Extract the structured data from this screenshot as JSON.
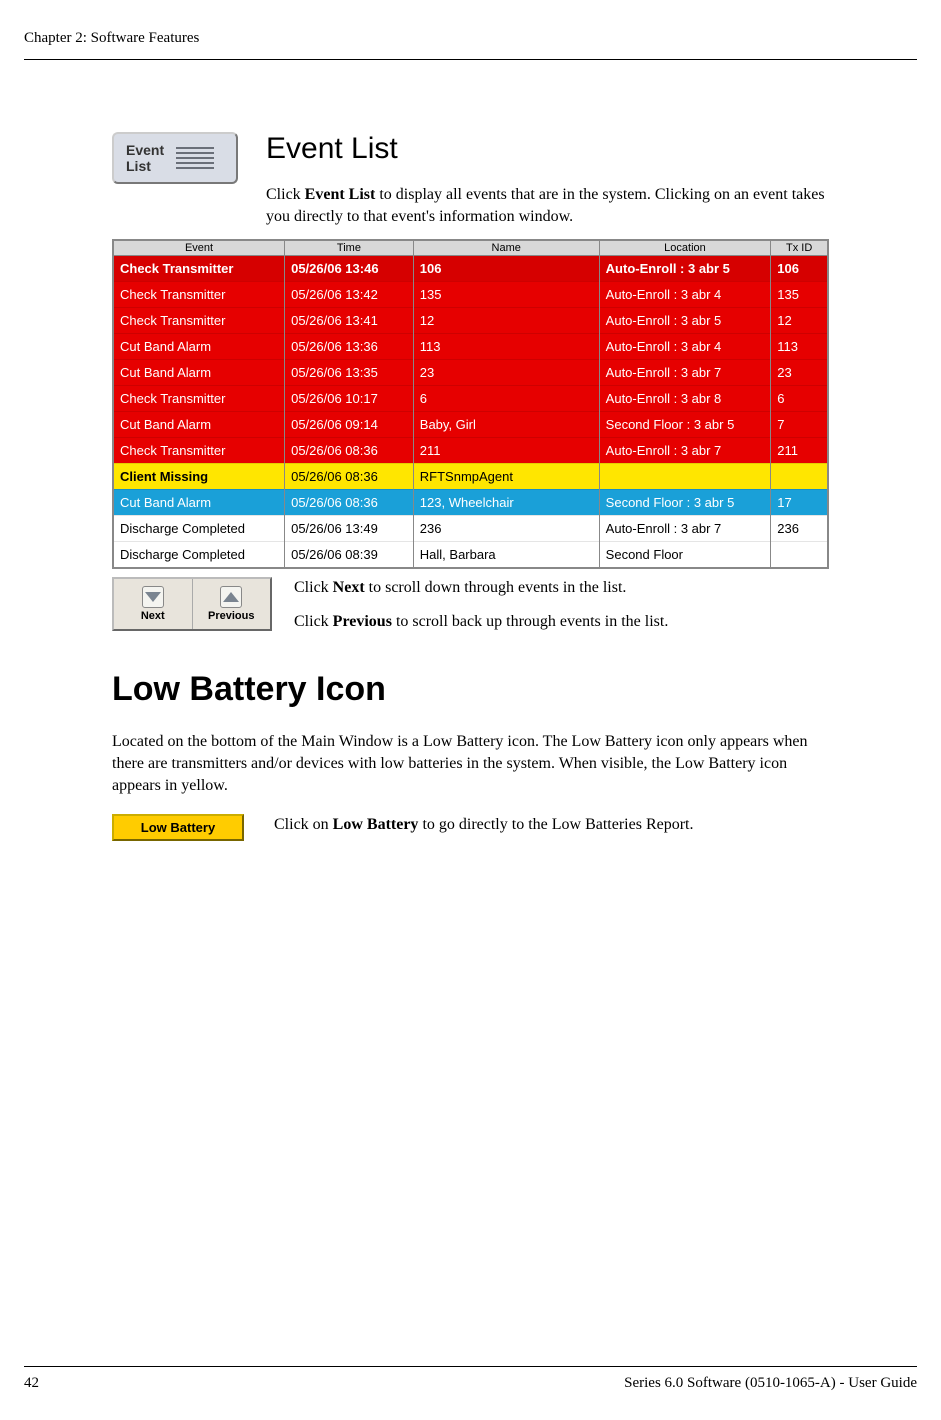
{
  "header": {
    "chapter": "Chapter 2: Software Features"
  },
  "eventlist": {
    "button_line1": "Event",
    "button_line2": "List",
    "title": "Event List",
    "intro_pre": "Click ",
    "intro_bold": "Event List",
    "intro_post": " to display all events that are in the system. Clicking on an event takes you directly to that event's information window.",
    "columns": [
      "Event",
      "Time",
      "Name",
      "Location",
      "Tx ID"
    ],
    "rows": [
      {
        "style": "red-bold",
        "event": "Check Transmitter",
        "time": "05/26/06 13:46",
        "name": "106",
        "location": "Auto-Enroll : 3 abr 5",
        "txid": "106"
      },
      {
        "style": "red",
        "event": "Check Transmitter",
        "time": "05/26/06 13:42",
        "name": "135",
        "location": "Auto-Enroll : 3 abr 4",
        "txid": "135"
      },
      {
        "style": "red",
        "event": "Check Transmitter",
        "time": "05/26/06 13:41",
        "name": "12",
        "location": "Auto-Enroll : 3 abr 5",
        "txid": "12"
      },
      {
        "style": "red",
        "event": "Cut Band Alarm",
        "time": "05/26/06 13:36",
        "name": "113",
        "location": "Auto-Enroll : 3 abr 4",
        "txid": "113"
      },
      {
        "style": "red",
        "event": "Cut Band Alarm",
        "time": "05/26/06 13:35",
        "name": "23",
        "location": "Auto-Enroll : 3 abr 7",
        "txid": "23"
      },
      {
        "style": "red",
        "event": "Check Transmitter",
        "time": "05/26/06 10:17",
        "name": "6",
        "location": "Auto-Enroll : 3 abr 8",
        "txid": "6"
      },
      {
        "style": "red",
        "event": "Cut Band Alarm",
        "time": "05/26/06 09:14",
        "name": "Baby, Girl",
        "location": "Second Floor : 3 abr 5",
        "txid": "7"
      },
      {
        "style": "red",
        "event": "Check Transmitter",
        "time": "05/26/06 08:36",
        "name": "211",
        "location": "Auto-Enroll : 3 abr 7",
        "txid": "211"
      },
      {
        "style": "yellow",
        "event": "Client Missing",
        "time": "05/26/06 08:36",
        "name": "RFTSnmpAgent",
        "location": "",
        "txid": ""
      },
      {
        "style": "blue",
        "event": "Cut Band Alarm",
        "time": "05/26/06 08:36",
        "name": "123, Wheelchair",
        "location": "Second Floor : 3 abr 5",
        "txid": "17"
      },
      {
        "style": "white",
        "event": "Discharge Completed",
        "time": "05/26/06 13:49",
        "name": "236",
        "location": "Auto-Enroll : 3 abr 7",
        "txid": "236"
      },
      {
        "style": "white",
        "event": "Discharge Completed",
        "time": "05/26/06 08:39",
        "name": "Hall, Barbara",
        "location": "Second Floor",
        "txid": ""
      }
    ],
    "next_label": "Next",
    "prev_label": "Previous",
    "next_pre": "Click ",
    "next_bold": "Next",
    "next_post": " to scroll down through events in the list.",
    "prev_pre": "Click ",
    "prev_bold": "Previous",
    "prev_post": " to scroll back up through events in the list."
  },
  "lowbattery": {
    "heading": "Low Battery Icon",
    "para": "Located on the bottom of the Main Window is a Low Battery icon. The Low Battery icon only appears when there are transmitters and/or devices with low batteries in the system. When visible, the Low Battery icon appears in yellow.",
    "button_label": "Low Battery",
    "click_pre": "Click on ",
    "click_bold": "Low Battery",
    "click_post": " to go directly to the Low Batteries Report."
  },
  "footer": {
    "page": "42",
    "right": "Series 6.0 Software (0510-1065-A) - User Guide"
  }
}
